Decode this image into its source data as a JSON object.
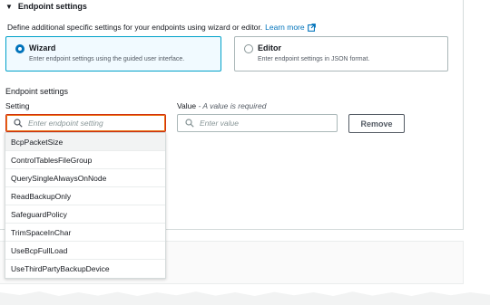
{
  "section": {
    "title": "Endpoint settings"
  },
  "intro": {
    "text": "Define additional specific settings for your endpoints using wizard or editor.",
    "link": "Learn more"
  },
  "mode_tiles": [
    {
      "title": "Wizard",
      "description": "Enter endpoint settings using the guided user interface.",
      "selected": true
    },
    {
      "title": "Editor",
      "description": "Enter endpoint settings in JSON format.",
      "selected": false
    }
  ],
  "settings": {
    "heading": "Endpoint settings",
    "setting_label": "Setting",
    "value_label": "Value",
    "value_hint": " - A value is required",
    "setting_placeholder": "Enter endpoint setting",
    "value_placeholder": "Enter value",
    "remove_label": "Remove"
  },
  "dropdown_options": [
    "BcpPacketSize",
    "ControlTablesFileGroup",
    "QuerySingleAlwaysOnNode",
    "ReadBackupOnly",
    "SafeguardPolicy",
    "TrimSpaceInChar",
    "UseBcpFullLoad",
    "UseThirdPartyBackupDevice"
  ],
  "colors": {
    "accent": "#0073bb",
    "focus_border": "#d13212",
    "selected_tile_bg": "#f1faff"
  }
}
